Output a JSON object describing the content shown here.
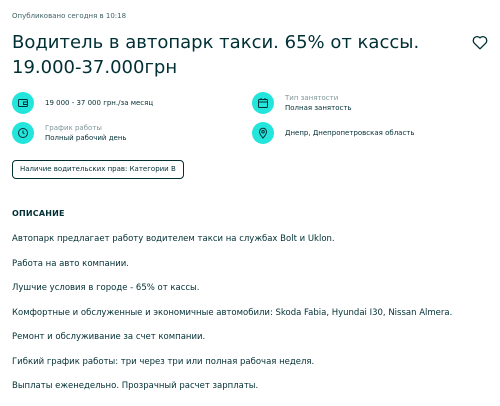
{
  "listing": {
    "published": "Опубликовано сегодня в 10:18",
    "title": "Водитель в автопарк такси. 65% от кассы. 19.000-37.000грн",
    "favorite_icon": "heart-outline-icon"
  },
  "info": {
    "salary": {
      "icon": "wallet-icon",
      "value": "19 000 - 37 000 грн./за месяц"
    },
    "employment_type": {
      "icon": "calendar-icon",
      "label": "Тип занятости",
      "value": "Полная занятость"
    },
    "schedule": {
      "icon": "clock-icon",
      "label": "График работы",
      "value": "Полный рабочий день"
    },
    "location": {
      "icon": "location-pin-icon",
      "value": "Днепр, Днепропетровская область"
    }
  },
  "tags": [
    "Наличие водительских прав: Категории B"
  ],
  "description": {
    "heading": "ОПИСАНИЕ",
    "lines": [
      "Автопарк предлагает работу водителем такси на службах Bolt и Uklon.",
      "Работа на авто компании.",
      "Лушчие условия в городе - 65% от кассы.",
      "Комфортные и обслуженные и экономичные автомобили: Skoda Fabia, Hyundai I30, Nissan Almera.",
      "Ремонт и обслуживание за счет компании.",
      "Гибкий график работы: три через три или полная рабочая неделя.",
      "Выплаты еженедельно. Прозрачный расчет зарплаты."
    ]
  },
  "colors": {
    "accent": "#23e5db",
    "text": "#002f34",
    "muted": "#7f9799"
  }
}
